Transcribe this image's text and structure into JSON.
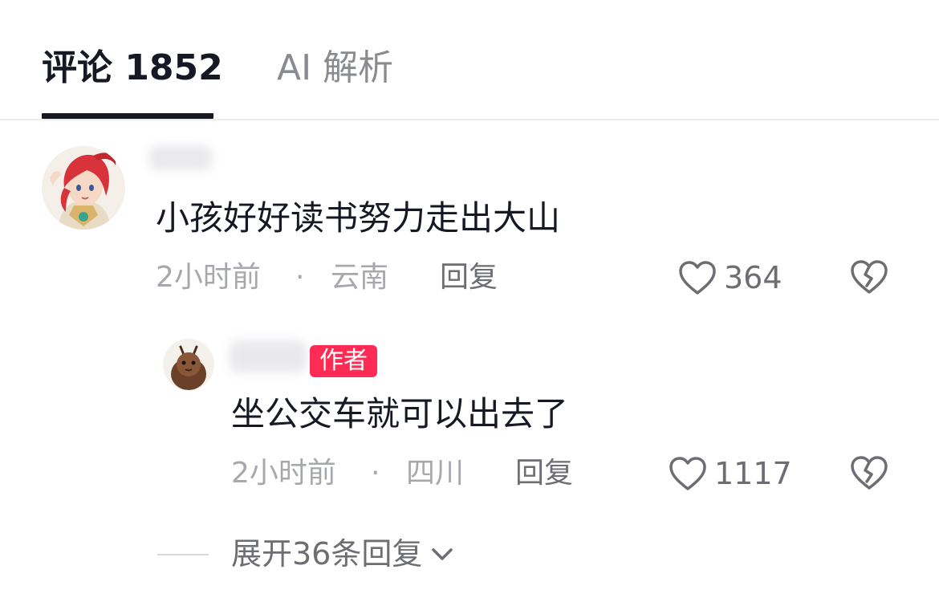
{
  "tabs": {
    "comments_label": "评论 1852",
    "ai_label": "AI 解析"
  },
  "comment": {
    "text": "小孩好好读书努力走出大山",
    "time": "2小时前",
    "separator": "·",
    "location": "云南",
    "reply_label": "回复",
    "likes": "364",
    "icons": {
      "like": "heart-outline-icon",
      "dislike": "broken-heart-icon"
    }
  },
  "reply": {
    "badge": "作者",
    "text": "坐公交车就可以出去了",
    "time": "2小时前",
    "separator": "·",
    "location": "四川",
    "reply_label": "回复",
    "likes": "1117",
    "icons": {
      "like": "heart-outline-icon",
      "dislike": "broken-heart-icon"
    }
  },
  "expand": {
    "label": "展开36条回复",
    "icon": "chevron-down-icon"
  },
  "colors": {
    "text_primary": "#161823",
    "text_secondary": "#a7a8ad",
    "action_gray": "#6d6e73",
    "author_badge": "#fe2c55",
    "divider": "#ececec"
  }
}
